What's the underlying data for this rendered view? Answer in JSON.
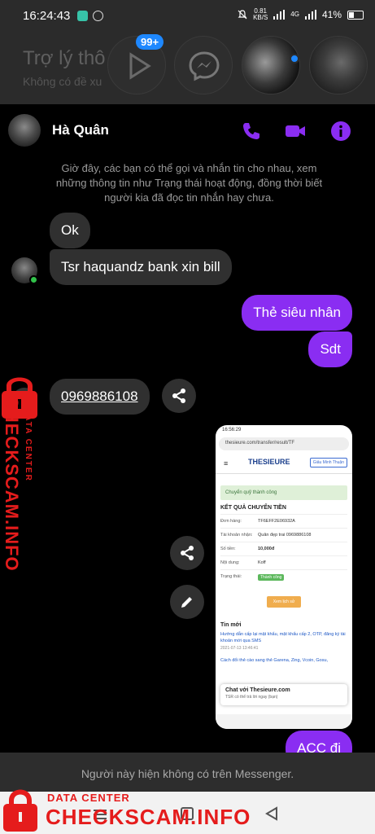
{
  "status_bar": {
    "time": "16:24:43",
    "net_speed": "0.81",
    "net_unit": "KB/S",
    "network": "4G",
    "battery": "41%"
  },
  "background_app": {
    "title": "Trợ lý thô",
    "subtitle": "Không có đề xu",
    "badge_count": "99+"
  },
  "chat": {
    "contact_name": "Hà Quân",
    "notice": "Giờ đây, các bạn có thể gọi và nhắn tin cho nhau, xem những thông tin như Trạng thái hoạt động, đồng thời biết người kia đã đọc tin nhắn hay chưa.",
    "messages": [
      {
        "from": "them",
        "text": "Ok"
      },
      {
        "from": "them",
        "text": "Tsr haquandz bank xin bill"
      },
      {
        "from": "me",
        "text": "Thẻ siêu nhân"
      },
      {
        "from": "me",
        "text": "Sdt"
      },
      {
        "from": "them",
        "text": "0969886108"
      },
      {
        "from": "me",
        "text": "ACC đi"
      }
    ],
    "footer_notice": "Người này hiện không có trên Messenger."
  },
  "attachment": {
    "time": "16:56:29",
    "url": "thesieure.com/transfer/result/TF",
    "site_name": "THESIEURE",
    "login_label": "Giấu Minh Thuận",
    "success_text": "Chuyển quỹ thành công",
    "heading": "KẾT QUẢ CHUYỂN TIỀN",
    "rows": [
      {
        "k": "Đơn hàng:",
        "v": "TF6EFF2E06932A"
      },
      {
        "k": "Tài khoản nhận:",
        "v": "Quân đẹp trai 0969886108"
      },
      {
        "k": "Số tiền:",
        "v": "10,000đ"
      },
      {
        "k": "Nội dung:",
        "v": "Koff"
      },
      {
        "k": "Trạng thái:",
        "v": "Thành công"
      }
    ],
    "button_label": "Xem lịch sử",
    "news_title": "Tin mới",
    "news_link": "Hướng dẫn cấp lại mật khẩu, mật khẩu cấp 2, OTP, đăng ký tài khoản mới qua SMS",
    "news_date": "2021-07-13 13:46:41",
    "news_link2": "Cách đổi thẻ cào sang thẻ Garena, Zing, Vcoin, Gosu,",
    "chat_title": "Chat với Thesieure.com",
    "chat_sub": "TSR có thể trả lời ngay (bạn)"
  },
  "watermark": {
    "top": "DATA CENTER",
    "main": "CHECKSCAM.INFO",
    "color": "#e51c1c"
  },
  "colors": {
    "accent": "#8a2df2",
    "incoming": "#303030",
    "online": "#31c24a"
  }
}
